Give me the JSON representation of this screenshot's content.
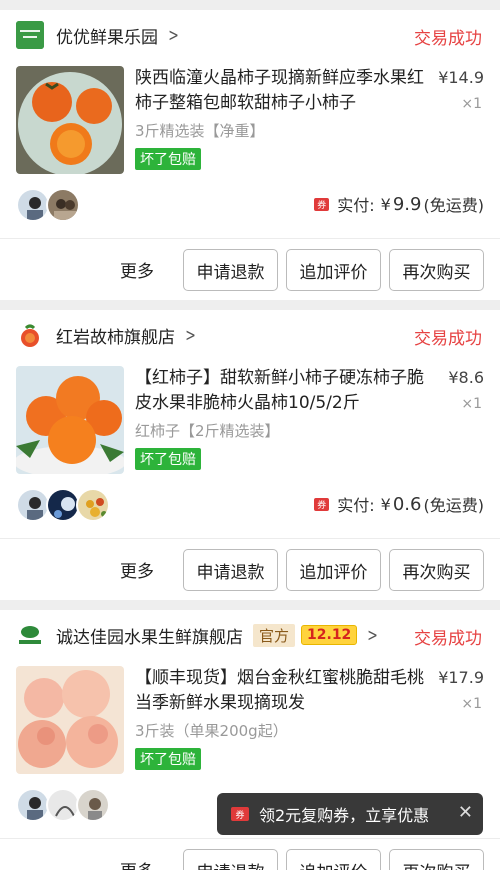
{
  "orders": [
    {
      "shop": {
        "name": "优优鲜果乐园",
        "logo_text": "优优鲜果乐园"
      },
      "status": "交易成功",
      "item": {
        "title": "陕西临潼火晶柿子现摘新鲜应季水果红柿子整箱包邮软甜柿子小柿子",
        "price": "¥14.9",
        "qty": "×1",
        "spec": "3斤精选装【净重】",
        "badge": "坏了包赔"
      },
      "paid": {
        "ticket": "券",
        "label": "实付:",
        "currency": "¥",
        "amount": "9.9",
        "shipping": "(免运费)"
      },
      "actions": {
        "more": "更多",
        "refund": "申请退款",
        "review": "追加评价",
        "rebuy": "再次购买"
      }
    },
    {
      "shop": {
        "name": "红岩故柿旗舰店"
      },
      "status": "交易成功",
      "item": {
        "title": "【红柿子】甜软新鲜小柿子硬冻柿子脆皮水果非脆柿火晶柿10/5/2斤",
        "price": "¥8.6",
        "qty": "×1",
        "spec": "红柿子【2斤精选装】",
        "badge": "坏了包赔"
      },
      "paid": {
        "ticket": "券",
        "label": "实付:",
        "currency": "¥",
        "amount": "0.6",
        "shipping": "(免运费)"
      },
      "actions": {
        "more": "更多",
        "refund": "申请退款",
        "review": "追加评价",
        "rebuy": "再次购买"
      }
    },
    {
      "shop": {
        "name": "诚达佳园水果生鲜旗舰店",
        "tag_official": "官方",
        "tag_promo": "12.12"
      },
      "status": "交易成功",
      "item": {
        "title": "【顺丰现货】烟台金秋红蜜桃脆甜毛桃当季新鲜水果现摘现发",
        "price": "¥17.9",
        "qty": "×1",
        "spec": "3斤装（单果200g起）",
        "badge": "坏了包赔"
      },
      "actions": {
        "more": "更多",
        "refund": "申请退款",
        "review": "追加评价",
        "rebuy": "再次购买"
      }
    }
  ],
  "toast": {
    "icon": "券",
    "text": "领2元复购券，立享优惠",
    "close": "✕"
  },
  "colors": {
    "status": "#e64343",
    "badge": "#2db33a",
    "accent": "#e03a3a"
  }
}
